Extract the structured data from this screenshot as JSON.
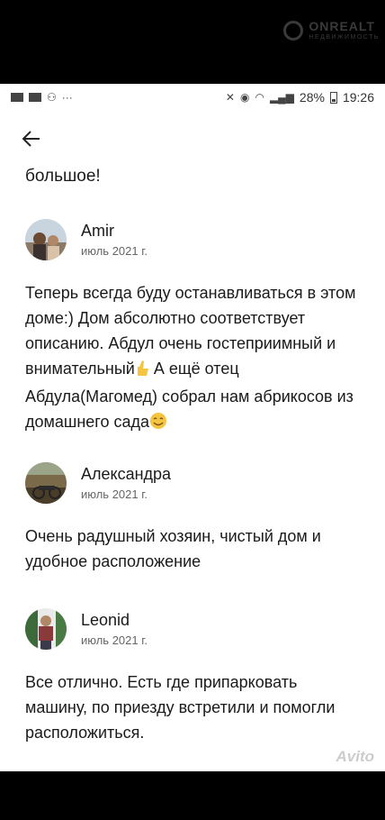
{
  "watermark": {
    "brand": "ONREALT",
    "sub": "НЕДВИЖИМОСТЬ"
  },
  "statusbar": {
    "battery": "28%",
    "time": "19:26"
  },
  "icons": {
    "back": "arrow-left-icon"
  },
  "fragment": "большое!",
  "reviews": [
    {
      "name": "Amir",
      "date": "июль 2021 г.",
      "text_1": "Теперь всегда буду останавливаться в этом доме:) Дом абсолютно соответствует описанию. Абдул очень гостеприимный и внимательный",
      "text_2": "А ещё отец Абдула(Магомед) собрал нам абрикосов из домашнего сада"
    },
    {
      "name": "Александра",
      "date": "июль 2021 г.",
      "text": "Очень радушный хозяин, чистый дом и удобное расположение"
    },
    {
      "name": "Leonid",
      "date": "июль 2021 г.",
      "text": "Все отлично. Есть где припарковать машину, по приезду встретили и помогли расположиться."
    }
  ],
  "avito_watermark": "Avito"
}
